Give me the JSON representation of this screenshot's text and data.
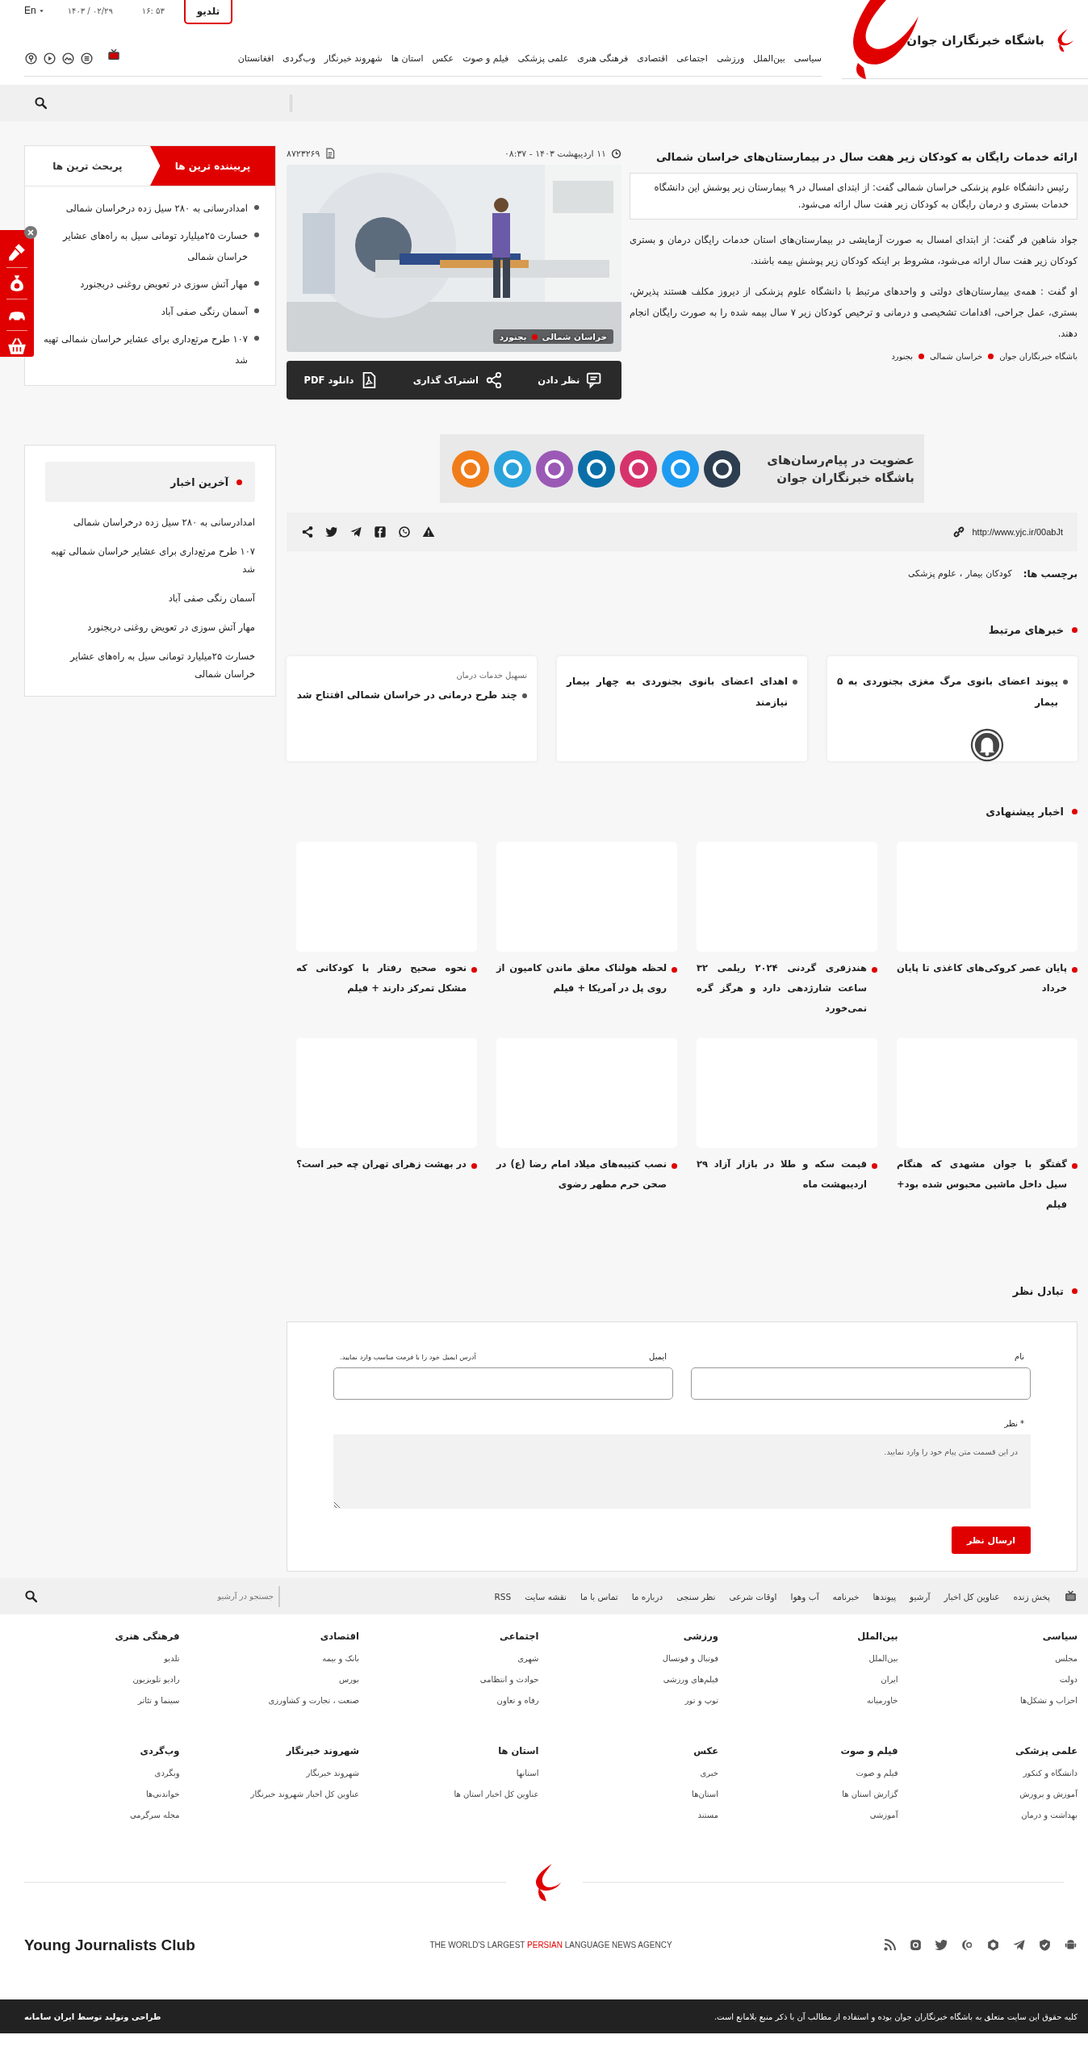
{
  "header": {
    "language": "En",
    "date": "۱۴۰۳ / ۰۲/۲۹",
    "time": "۱۶: ۵۳",
    "tv_button": "تلدیو",
    "site_name": "باشگاه خبرنگاران جوان",
    "nav": [
      "سیاسی",
      "بین‌الملل",
      "ورزشی",
      "اجتماعی",
      "اقتصادی",
      "فرهنگی هنری",
      "علمی پزشکی",
      "فیلم و صوت",
      "عکس",
      "استان ها",
      "شهروند خبرنگار",
      "وب‌گردی",
      "افغانستان"
    ]
  },
  "sidebar": {
    "tabs": [
      {
        "label": "پربیننده ترین ها",
        "selected": true
      },
      {
        "label": "پربحث ترین ها",
        "selected": false
      }
    ],
    "most_viewed": [
      "امدادرسانی به ۲۸۰ سیل زده درخراسان شمالی",
      "خسارت ۲۵میلیارد تومانی سیل به راه‌های عشایر خراسان شمالی",
      "مهار آتش سوزی در تعویض روغنی دربجنورد",
      "آسمان رنگی صفی آباد",
      "۱۰۷ طرح مرتع‌داری برای عشایر خراسان شمالی تهیه شد"
    ],
    "latest": {
      "title": "آخرین اخبار",
      "items": [
        "امدادرسانی به ۲۸۰ سیل زده درخراسان شمالی",
        "۱۰۷ طرح مرتع‌داری برای عشایر خراسان شمالی تهیه شد",
        "آسمان رنگی صفی آباد",
        "مهار آتش سوزی در تعویض روغنی دربجنورد",
        "خسارت ۲۵میلیارد تومانی سیل به راه‌های عشایر خراسان شمالی"
      ]
    }
  },
  "article": {
    "title": "ارائه خدمات رایگان به کودکان زیر هفت سال در بیمارستان‌های خراسان شمالی",
    "date": "۱۱ اردیبهشت ۱۴۰۳ - ۰۸:۳۷",
    "news_id": "۸۷۲۳۲۶۹",
    "lead": "رئیس دانشگاه علوم پزشکی خراسان شمالی گفت: از ابتدای امسال در ۹ بیمارستان زیر پوشش این دانشگاه خدمات بستری و درمان رایگان به کودکان زیر هفت سال ارائه می‌شود.",
    "paragraphs": [
      "جواد شاهین فر گفت: از ابتدای امسال به صورت آزمایشی در بیمارستان‌های استان خدمات رایگان درمان و بستری کودکان زیر هفت سال ارائه می‌شود، مشروط بر اینکه کودکان زیر پوشش بیمه باشند.",
      "او گفت : همه‌ی بیمارستان‌های دولتی و واحدهای مرتبط با دانشگاه علوم پزشکی از دیروز مکلف هستند پذیرش، بستری، عمل جراحی، اقدامات تشخیصی و درمانی و ترخیص کودکان زیر ۷ سال بیمه شده را به صورت رایگان انجام دهند."
    ],
    "breadcrumb": [
      "باشگاه خبرنگاران جوان",
      "خراسان شمالی",
      "بجنورد"
    ],
    "image_tags": [
      "خراسان شمالی",
      "بجنورد"
    ],
    "actions": [
      {
        "kind": "comment",
        "label": "نظر دادن"
      },
      {
        "kind": "share",
        "label": "اشتراک گذاری"
      },
      {
        "kind": "pdf",
        "label": "دانلود PDF"
      }
    ],
    "banner": [
      "عضویت در پیام‌رسان‌های",
      "باشگاه خبرنگاران جوان"
    ],
    "short_link": "http://www.yjc.ir/00abJt",
    "tags_label": "برچسب ها:",
    "tags": [
      "کودکان بیمار",
      "علوم پزشکی"
    ],
    "tag_separator": "،"
  },
  "related": {
    "title": "خبرهای مرتبط",
    "items": [
      {
        "title": "پیوند اعضای بانوی مرگ مغزی بجنوردی به ۵ بیمار"
      },
      {
        "title": "اهدای اعضای بانوی بجنوردی به چهار بیمار نیازمند"
      },
      {
        "kicker": "تسهیل خدمات درمان",
        "title": "چند طرح درمانی در خراسان شمالی افتتاح شد"
      }
    ]
  },
  "suggested": {
    "title": "اخبار پیشنهادی",
    "items": [
      "پایان عصر کروکی‌های کاغذی تا پایان خرداد",
      "هندزفری گردنی ۲۰۲۴ ریلمی ۳۲ ساعت شارژدهی دارد و هرگز گره نمی‌خورد",
      "لحظه هولناک معلق ماندن کامیون از روی پل در آمریکا + فیلم",
      "نحوه صحیح رفتار با کودکانی که مشکل تمرکز دارند + فیلم",
      "گفتگو با جوان مشهدی که هنگام سیل داخل ماشین محبوس شده بود+ فیلم",
      "قیمت سکه و طلا در بازار آزاد ۲۹ اردیبهشت ماه",
      "نصب کتیبه‌های میلاد امام رضا (ع) در صحن حرم مطهر رضوی",
      "در بهشت زهرای تهران چه خبر است؟"
    ]
  },
  "comments": {
    "title": "تبادل نظر",
    "name_label": "نام",
    "email_label": "ایمیل",
    "email_hint": "آدرس ایمیل خود را با فرمت مناسب وارد نمایید.",
    "comment_label": "نظر",
    "required_mark": "*",
    "placeholder": "در این قسمت متن پیام خود را وارد نمایید.",
    "submit": "ارسال نظر"
  },
  "footer": {
    "links": [
      "پخش زنده",
      "عناوین کل اخبار",
      "آرشیو",
      "پیوندها",
      "خبرنامه",
      "آب وهوا",
      "اوقات شرعی",
      "نظر سنجی",
      "درباره ما",
      "تماس با ما",
      "نقشه سایت",
      "RSS"
    ],
    "search_placeholder": "جستجو در آرشیو",
    "columns": [
      {
        "title": "سیاسی",
        "links": [
          "مجلس",
          "دولت",
          "احزاب و تشکل‌ها"
        ]
      },
      {
        "title": "بین‌الملل",
        "links": [
          "بین‌الملل",
          "ایران",
          "خاورمیانه"
        ]
      },
      {
        "title": "ورزشی",
        "links": [
          "فوتبال و فوتسال",
          "فیلم‌های ورزشی",
          "توپ و تور"
        ]
      },
      {
        "title": "اجتماعی",
        "links": [
          "شهری",
          "حوادث و انتظامی",
          "رفاه و تعاون"
        ]
      },
      {
        "title": "اقتصادی",
        "links": [
          "بانک و بیمه",
          "بورس",
          "صنعت ، تجارت و کشاورزی"
        ]
      },
      {
        "title": "فرهنگی هنری",
        "links": [
          "تلدیو",
          "رادیو تلویزیون",
          "سینما و تئاتر"
        ]
      },
      {
        "title": "علمی پزشکی",
        "links": [
          "دانشگاه و کنکور",
          "آموزش و پرورش",
          "بهداشت و درمان"
        ]
      },
      {
        "title": "فیلم و صوت",
        "links": [
          "فیلم و صوت",
          "گزارش استان ها",
          "آموزشی"
        ]
      },
      {
        "title": "عکس",
        "links": [
          "خبری",
          "استان‌ها",
          "مستند"
        ]
      },
      {
        "title": "استان ها",
        "links": [
          "استانها",
          "عناوین کل اخبار استان ها"
        ]
      },
      {
        "title": "شهروند خبرنگار",
        "links": [
          "شهروند خبرنگار",
          "عناوین کل اخبار شهروند خبرنگار"
        ]
      },
      {
        "title": "وب‌گردی",
        "links": [
          "وبگردی",
          "خواندنی‌ها",
          "مجله سرگرمی"
        ]
      }
    ],
    "brand": "Young Journalists Club",
    "tagline": {
      "before": "THE WORLD'S LARGEST ",
      "highlight": "PERSIAN",
      "after": " LANGUAGE NEWS AGENCY"
    },
    "copyright": "کلیه حقوق این سایت متعلق به باشگاه خبرنگاران جوان بوده و استفاده از مطالب آن با ذکر منبع بلامانع است.",
    "credit": "طراحی وتولید توسط ایران سامانه"
  }
}
